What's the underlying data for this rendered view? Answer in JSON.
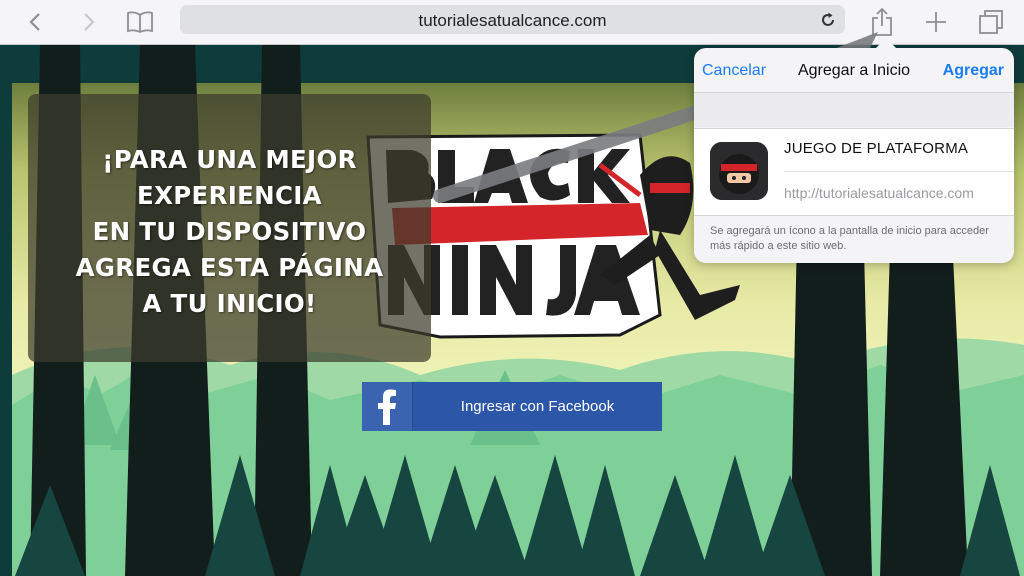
{
  "browser": {
    "url_display": "tutorialesatualcance.com",
    "icons": [
      "back-icon",
      "forward-icon",
      "bookmarks-icon",
      "reload-icon",
      "share-icon",
      "new-tab-icon",
      "tabs-icon"
    ]
  },
  "page": {
    "message": "¡PARA UNA MEJOR\nEXPERIENCIA\nEN TU DISPOSITIVO\nAGREGA ESTA PÁGINA\nA TU INICIO!",
    "logo_text": "BLACK NINJA",
    "facebook_button": "Ingresar con Facebook"
  },
  "share_sheet": {
    "cancel": "Cancelar",
    "title": "Agregar a Inicio",
    "add": "Agregar",
    "app_name": "JUEGO DE PLATAFORMA",
    "url": "http://tutorialesatualcance.com",
    "note": "Se agregará un ícono a la pantalla de inicio para acceder más rápido a este sitio web."
  },
  "colors": {
    "ios_blue": "#1a7cf5",
    "facebook": "#2c57a8",
    "logo_red": "#d3252a"
  }
}
